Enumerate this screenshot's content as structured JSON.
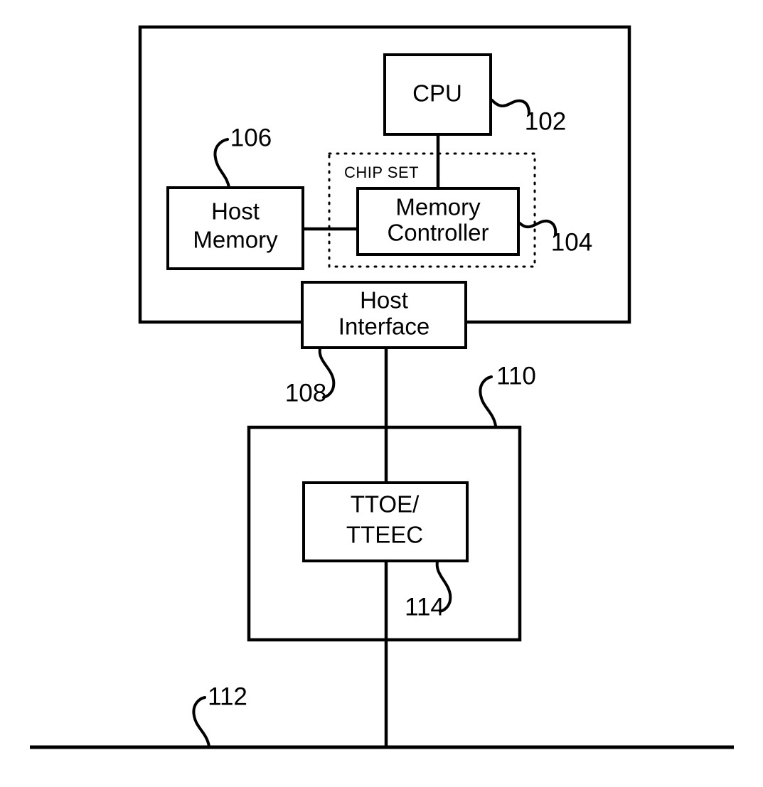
{
  "figure": {
    "type": "patent-block-diagram",
    "background_color": "#ffffff",
    "line_color": "#000000"
  },
  "blocks": {
    "host_system": {
      "label": ""
    },
    "cpu": {
      "label": "CPU"
    },
    "memory_controller": {
      "label_line1": "Memory",
      "label_line2": "Controller"
    },
    "host_memory": {
      "label_line1": "Host",
      "label_line2": "Memory"
    },
    "host_interface": {
      "label_line1": "Host",
      "label_line2": "Interface"
    },
    "chipset": {
      "label": "CHIP SET"
    },
    "nic": {
      "label": ""
    },
    "ttoe": {
      "label_line1": "TTOE/",
      "label_line2": "TTEEC"
    }
  },
  "reference_numerals": {
    "cpu": "102",
    "memory_controller": "104",
    "host_memory": "106",
    "host_interface": "108",
    "nic": "110",
    "network": "112",
    "ttoe": "114"
  }
}
